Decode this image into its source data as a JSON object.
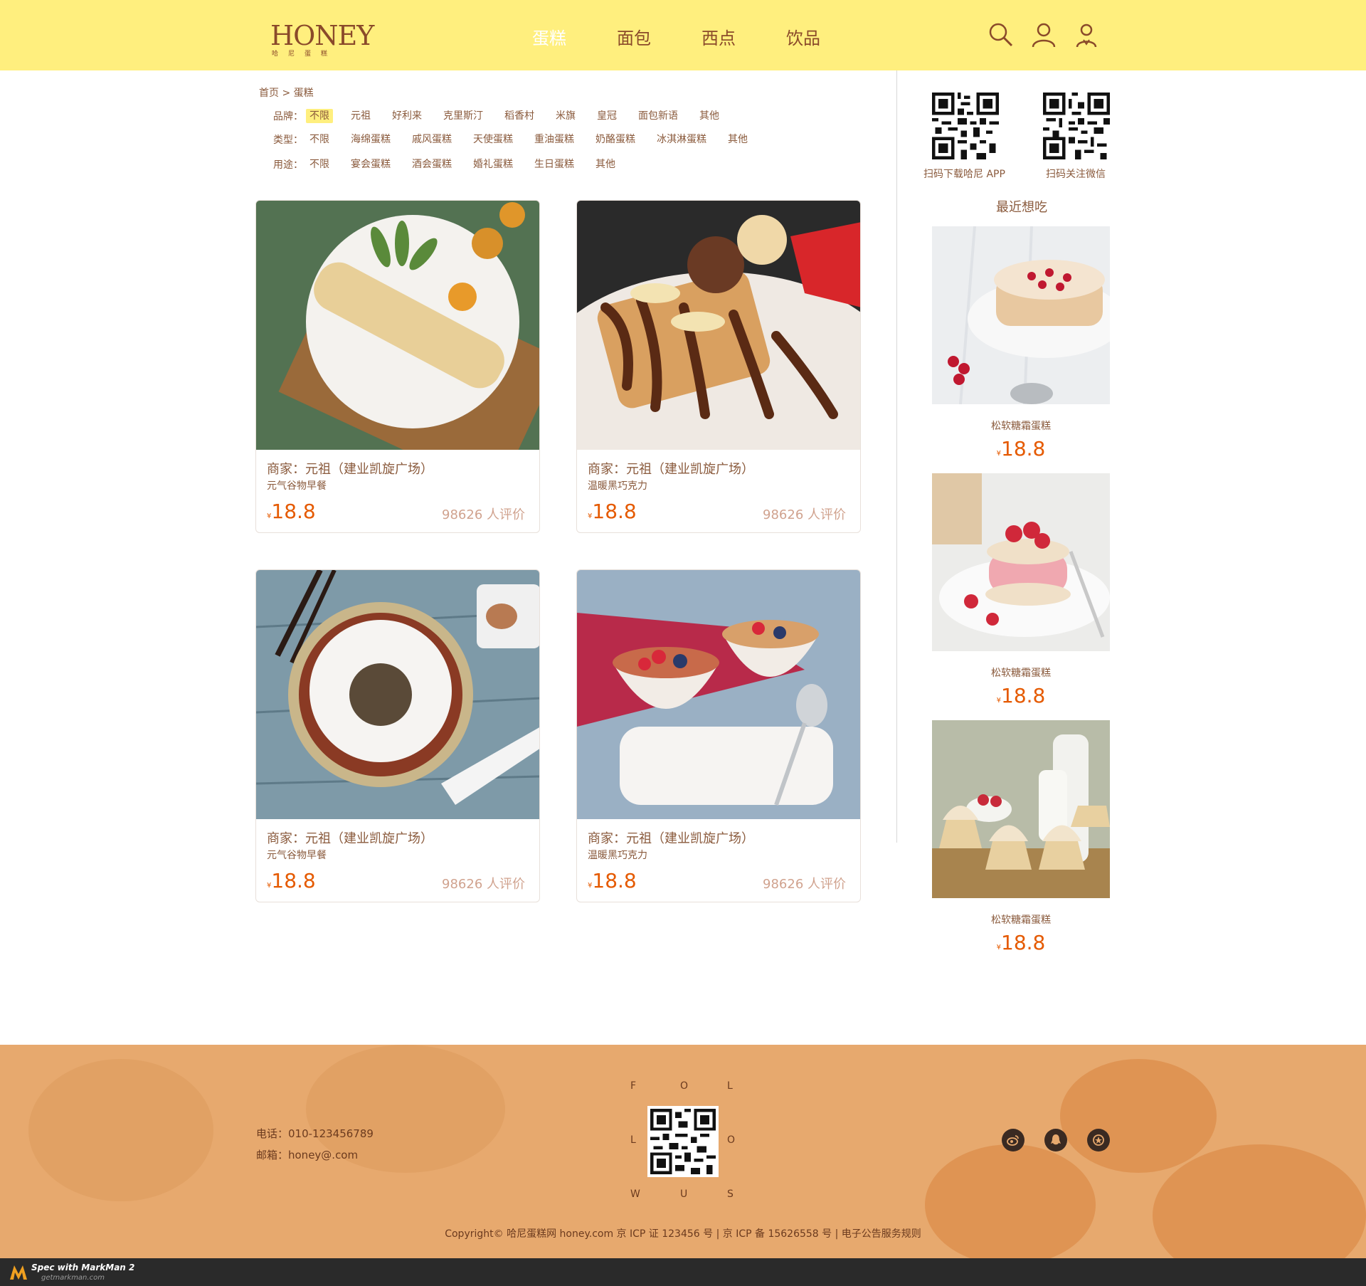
{
  "header": {
    "logo_text": "HONEY",
    "logo_sub": "哈尼蛋糕",
    "nav": [
      {
        "label": "蛋糕",
        "active": true
      },
      {
        "label": "面包",
        "active": false
      },
      {
        "label": "西点",
        "active": false
      },
      {
        "label": "饮品",
        "active": false
      }
    ],
    "icons": [
      "search-icon",
      "user-icon",
      "account-icon"
    ],
    "bg_color": "#ffef7e"
  },
  "breadcrumb": "首页 > 蛋糕",
  "filters": [
    {
      "label": "品牌：",
      "options": [
        "不限",
        "元祖",
        "好利来",
        "克里斯汀",
        "稻香村",
        "米旗",
        "皇冠",
        "面包新语",
        "其他"
      ],
      "selected": 0
    },
    {
      "label": "类型：",
      "options": [
        "不限",
        "海绵蛋糕",
        "戚风蛋糕",
        "天使蛋糕",
        "重油蛋糕",
        "奶酪蛋糕",
        "冰淇淋蛋糕",
        "其他"
      ],
      "selected": -1
    },
    {
      "label": "用途：",
      "options": [
        "不限",
        "宴会蛋糕",
        "酒会蛋糕",
        "婚礼蛋糕",
        "生日蛋糕",
        "其他"
      ],
      "selected": -1
    }
  ],
  "products": [
    {
      "shop": "商家：元祖（建业凯旋广场）",
      "desc": "元气谷物早餐",
      "currency": "¥",
      "price": "18.8",
      "reviews": "98626 人评价"
    },
    {
      "shop": "商家：元祖（建业凯旋广场）",
      "desc": "温暖黑巧克力",
      "currency": "¥",
      "price": "18.8",
      "reviews": "98626 人评价"
    },
    {
      "shop": "商家：元祖（建业凯旋广场）",
      "desc": "元气谷物早餐",
      "currency": "¥",
      "price": "18.8",
      "reviews": "98626 人评价"
    },
    {
      "shop": "商家：元祖（建业凯旋广场）",
      "desc": "温暖黑巧克力",
      "currency": "¥",
      "price": "18.8",
      "reviews": "98626 人评价"
    }
  ],
  "qr": [
    {
      "caption": "扫码下载哈尼 APP"
    },
    {
      "caption": "扫码关注微信"
    }
  ],
  "recent": {
    "title": "最近想吃",
    "items": [
      {
        "name": "松软糖霜蛋糕",
        "currency": "¥",
        "price": "18.8"
      },
      {
        "name": "松软糖霜蛋糕",
        "currency": "¥",
        "price": "18.8"
      },
      {
        "name": "松软糖霜蛋糕",
        "currency": "¥",
        "price": "18.8"
      }
    ]
  },
  "footer": {
    "phone": "电话：010-123456789",
    "email": "邮箱：honey@.com",
    "follow_letters": [
      "F",
      "O",
      "L",
      "L",
      "O",
      "W",
      "U",
      "S"
    ],
    "social": [
      "weibo-icon",
      "qq-icon",
      "favorite-icon"
    ],
    "copyright": "Copyright© 哈尼蛋糕网 honey.com 京 ICP 证 123456 号 | 京 ICP 备 15626558 号 | 电子公告服务规则"
  },
  "markman": {
    "title": "Spec with MarkMan 2",
    "url": "getmarkman.com"
  },
  "colors": {
    "accent": "#ffef7e",
    "price": "#e55a00",
    "text": "#8a5a3c",
    "reviews": "#d0a28e",
    "divider": "#d7d7d7",
    "footer": "#e7a96e"
  }
}
